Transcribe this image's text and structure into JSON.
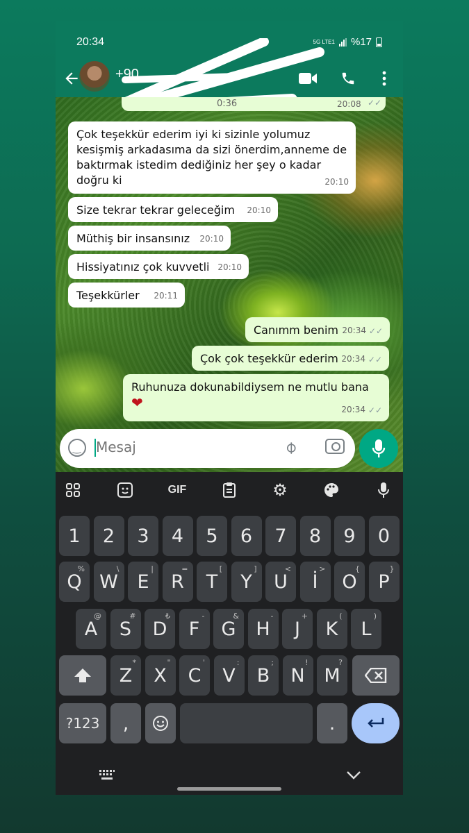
{
  "status_bar": {
    "time": "20:34",
    "network": "5G LTE1",
    "battery": "%17"
  },
  "header": {
    "contact": "+90"
  },
  "chat": {
    "top_partial": {
      "duration": "0:36",
      "time": "20:08"
    },
    "messages": [
      {
        "dir": "in",
        "text": "Çok teşekkür ederim iyi ki sizinle yolumuz kesişmiş arkadasıma da sizi önerdim,anneme de baktırmak istedim dediğiniz her şey o kadar doğru ki",
        "time": "20:10"
      },
      {
        "dir": "in",
        "text": "Size tekrar tekrar geleceğim",
        "time": "20:10"
      },
      {
        "dir": "in",
        "text": "Müthiş bir insansınız",
        "time": "20:10"
      },
      {
        "dir": "in",
        "text": "Hissiyatınız çok kuvvetli",
        "time": "20:10"
      },
      {
        "dir": "in",
        "text": "Teşekkürler",
        "time": "20:11"
      },
      {
        "dir": "out",
        "text": "Canımm benim",
        "time": "20:34"
      },
      {
        "dir": "out",
        "text": "Çok çok teşekkür ederim",
        "time": "20:34"
      },
      {
        "dir": "out",
        "text": "Ruhunuza dokunabildiysem ne mutlu bana",
        "emoji": "❤",
        "time": "20:34"
      }
    ]
  },
  "input": {
    "placeholder": "Mesaj"
  },
  "keyboard": {
    "toolbar": {
      "gif": "GIF"
    },
    "numbers": [
      "1",
      "2",
      "3",
      "4",
      "5",
      "6",
      "7",
      "8",
      "9",
      "0"
    ],
    "row1": [
      [
        "Q",
        "%"
      ],
      [
        "W",
        "\\"
      ],
      [
        "E",
        "|"
      ],
      [
        "R",
        "="
      ],
      [
        "T",
        "["
      ],
      [
        "Y",
        "]"
      ],
      [
        "U",
        "<"
      ],
      [
        "İ",
        ">"
      ],
      [
        "O",
        "{"
      ],
      [
        "P",
        "}"
      ]
    ],
    "row2": [
      [
        "A",
        "@"
      ],
      [
        "S",
        "#"
      ],
      [
        "D",
        "₺"
      ],
      [
        "F",
        "-"
      ],
      [
        "G",
        "&"
      ],
      [
        "H",
        "-"
      ],
      [
        "J",
        "+"
      ],
      [
        "K",
        "("
      ],
      [
        "L",
        ")"
      ]
    ],
    "row3": [
      [
        "Z",
        "*"
      ],
      [
        "X",
        "\""
      ],
      [
        "C",
        "'"
      ],
      [
        "V",
        ":"
      ],
      [
        "B",
        ";"
      ],
      [
        "N",
        "!"
      ],
      [
        "M",
        "?"
      ]
    ],
    "symbols_key": "?123",
    "comma_key": ",",
    "period_key": "."
  },
  "colors": {
    "accent": "#00a884",
    "header": "#0c7a5d",
    "outgoing_bubble": "#e7fdd5",
    "keyboard_bg": "#1f2022"
  }
}
